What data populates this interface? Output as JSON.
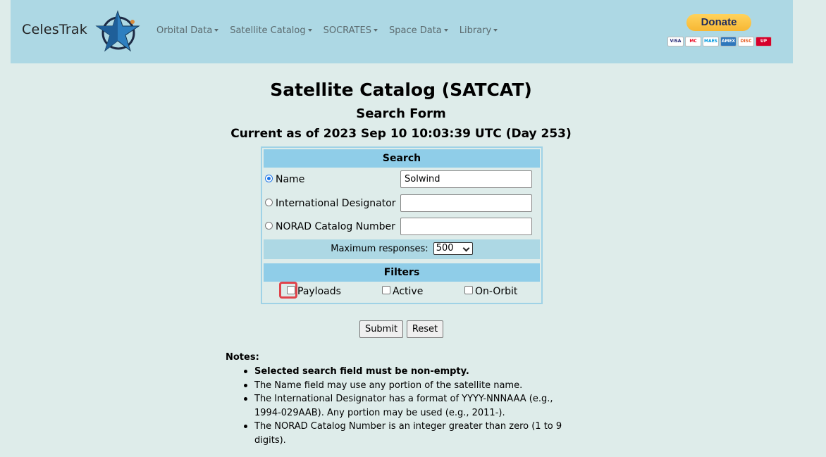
{
  "header": {
    "brand": "CelesTrak",
    "nav": [
      {
        "label": "Orbital Data"
      },
      {
        "label": "Satellite Catalog"
      },
      {
        "label": "SOCRATES"
      },
      {
        "label": "Space Data"
      },
      {
        "label": "Library"
      }
    ],
    "donate_label": "Donate",
    "cards": [
      "VISA",
      "MC",
      "MAES",
      "AMEX",
      "DISC",
      "UP"
    ]
  },
  "page": {
    "title": "Satellite Catalog (SATCAT)",
    "subtitle": "Search Form",
    "current_as_of": "Current as of 2023 Sep 10 10:03:39 UTC (Day 253)"
  },
  "search": {
    "header": "Search",
    "fields": [
      {
        "label": "Name",
        "value": "Solwind",
        "checked": true
      },
      {
        "label": "International Designator",
        "value": "",
        "checked": false
      },
      {
        "label": "NORAD Catalog Number",
        "value": "",
        "checked": false
      }
    ],
    "max_label": "Maximum responses:",
    "max_value": "500"
  },
  "filters": {
    "header": "Filters",
    "items": [
      {
        "label": "Payloads"
      },
      {
        "label": "Active"
      },
      {
        "label": "On-Orbit"
      }
    ]
  },
  "buttons": {
    "submit": "Submit",
    "reset": "Reset"
  },
  "notes": {
    "heading": "Notes:",
    "items": [
      "Selected search field must be non-empty.",
      "The Name field may use any portion of the satellite name.",
      "The International Designator has a format of YYYY-NNNAAA (e.g., 1994-029AAB). Any portion may be used (e.g., 2011-).",
      "The NORAD Catalog Number is an integer greater than zero (1 to 9 digits)."
    ]
  },
  "colors": {
    "header_bg": "#add8e4",
    "section_bg": "#8fcde8",
    "highlight": "#e0444c",
    "donate": "#f7b733"
  }
}
